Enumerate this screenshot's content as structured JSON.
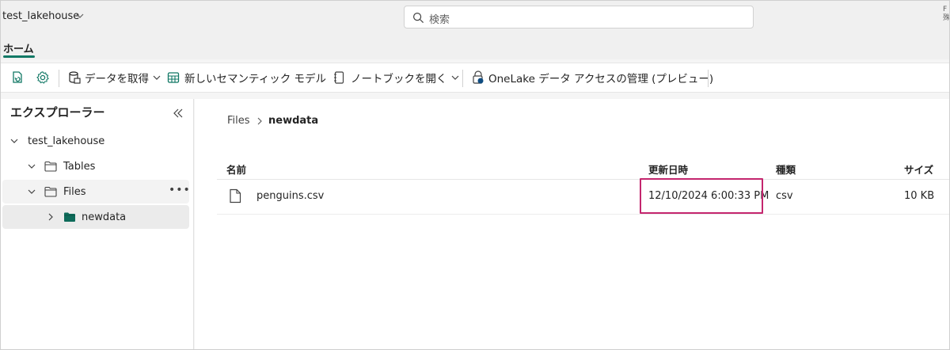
{
  "header": {
    "workspace_name": "test_lakehouse",
    "search_placeholder": "検索",
    "corner_text": "F\n殊"
  },
  "tabs": [
    {
      "label": "ホーム",
      "active": true
    }
  ],
  "toolbar": {
    "get_data": "データを取得",
    "new_semantic_model": "新しいセマンティック モデル",
    "open_notebook": "ノートブックを開く",
    "onelake_access": "OneLake データ アクセスの管理 (プレビュー)"
  },
  "explorer": {
    "title": "エクスプローラー",
    "tree": {
      "root": "test_lakehouse",
      "tables": "Tables",
      "files": "Files",
      "newdata": "newdata"
    }
  },
  "breadcrumb": {
    "root": "Files",
    "current": "newdata"
  },
  "table": {
    "columns": [
      "名前",
      "更新日時",
      "種類",
      "サイズ"
    ],
    "rows": [
      {
        "name": "penguins.csv",
        "modified": "12/10/2024 6:00:33 PM",
        "type": "csv",
        "size": "10 KB"
      }
    ]
  },
  "colors": {
    "accent": "#117865",
    "highlight": "#c4266e",
    "folder_fill": "#0e6b5a"
  },
  "icons": {
    "search": "search-icon",
    "collapse": "double-chevron-left-icon",
    "file": "document-icon",
    "folder": "folder-icon"
  }
}
